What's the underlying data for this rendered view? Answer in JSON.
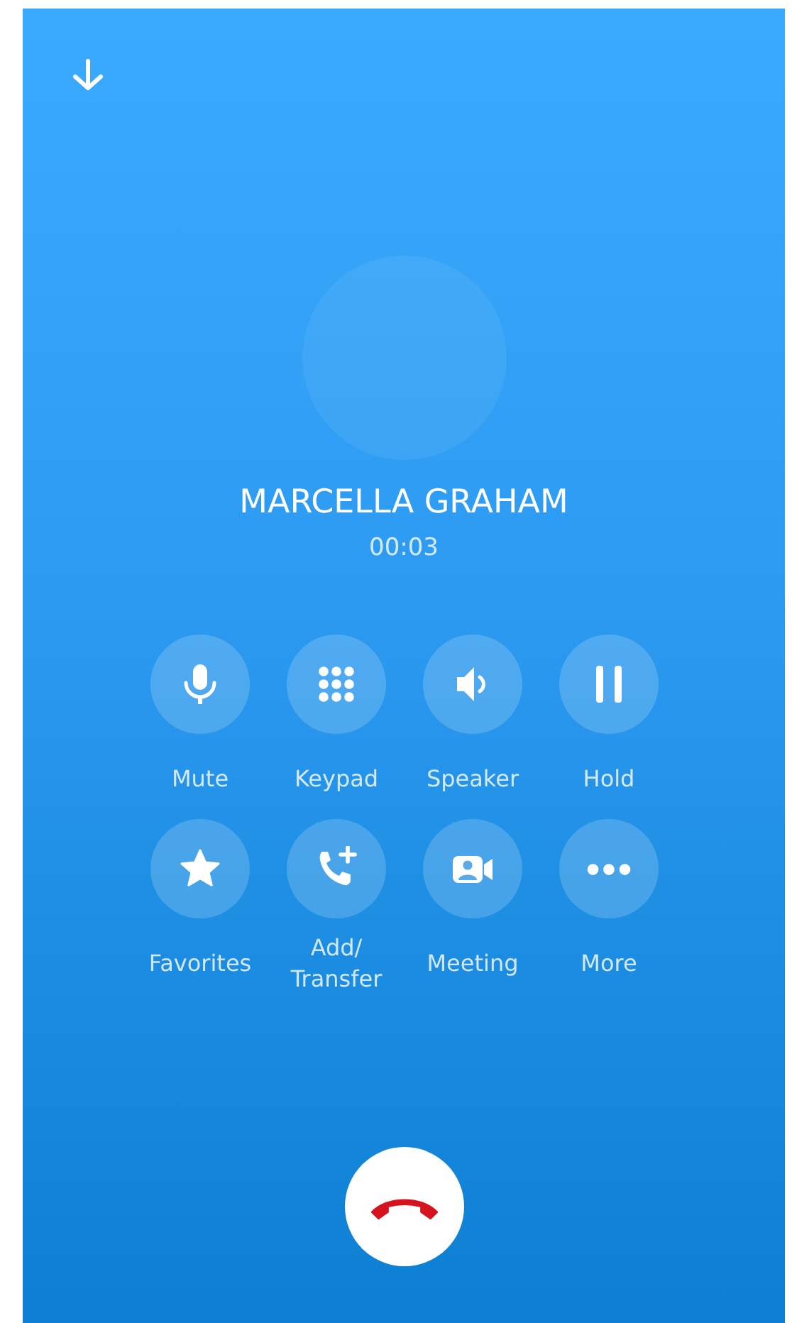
{
  "caller": {
    "name": "MARCELLA GRAHAM",
    "duration": "00:03"
  },
  "controls": [
    {
      "kind": "mute",
      "label": "Mute"
    },
    {
      "kind": "keypad",
      "label": "Keypad"
    },
    {
      "kind": "speaker",
      "label": "Speaker"
    },
    {
      "kind": "hold",
      "label": "Hold"
    },
    {
      "kind": "favorites",
      "label": "Favorites"
    },
    {
      "kind": "add",
      "label": "Add/ Transfer"
    },
    {
      "kind": "meeting",
      "label": "Meeting"
    },
    {
      "kind": "more",
      "label": "More"
    }
  ]
}
